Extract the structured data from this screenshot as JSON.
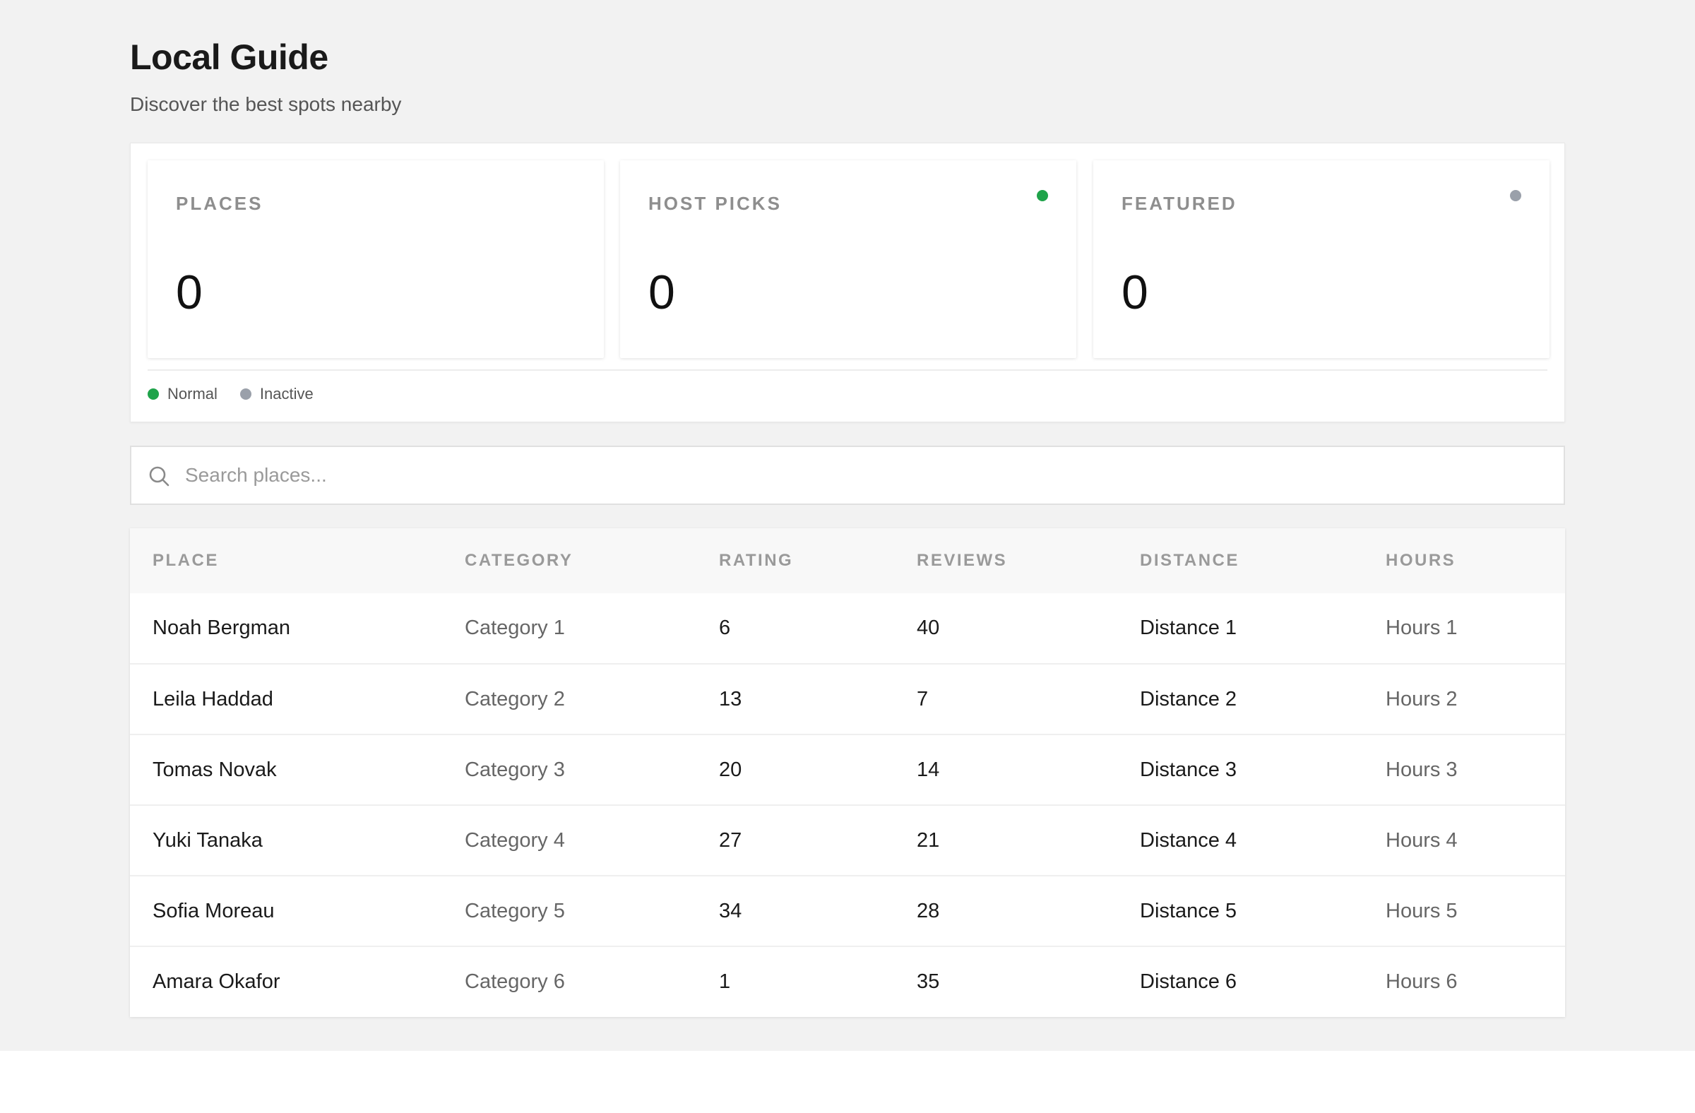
{
  "header": {
    "title": "Local Guide",
    "subtitle": "Discover the best spots nearby"
  },
  "stats": [
    {
      "label": "PLACES",
      "value": "0",
      "status": null
    },
    {
      "label": "HOST PICKS",
      "value": "0",
      "status": "normal"
    },
    {
      "label": "FEATURED",
      "value": "0",
      "status": "inactive"
    }
  ],
  "legend": [
    {
      "label": "Normal",
      "color": "#1fa34a"
    },
    {
      "label": "Inactive",
      "color": "#9aa0aa"
    }
  ],
  "colors": {
    "normal": "#1fa34a",
    "inactive": "#9aa0aa"
  },
  "search": {
    "placeholder": "Search places...",
    "value": ""
  },
  "table": {
    "columns": [
      "PLACE",
      "CATEGORY",
      "RATING",
      "REVIEWS",
      "DISTANCE",
      "HOURS"
    ],
    "rows": [
      [
        "Noah Bergman",
        "Category 1",
        "6",
        "40",
        "Distance 1",
        "Hours 1"
      ],
      [
        "Leila Haddad",
        "Category 2",
        "13",
        "7",
        "Distance 2",
        "Hours 2"
      ],
      [
        "Tomas Novak",
        "Category 3",
        "20",
        "14",
        "Distance 3",
        "Hours 3"
      ],
      [
        "Yuki Tanaka",
        "Category 4",
        "27",
        "21",
        "Distance 4",
        "Hours 4"
      ],
      [
        "Sofia Moreau",
        "Category 5",
        "34",
        "28",
        "Distance 5",
        "Hours 5"
      ],
      [
        "Amara Okafor",
        "Category 6",
        "1",
        "35",
        "Distance 6",
        "Hours 6"
      ]
    ]
  }
}
